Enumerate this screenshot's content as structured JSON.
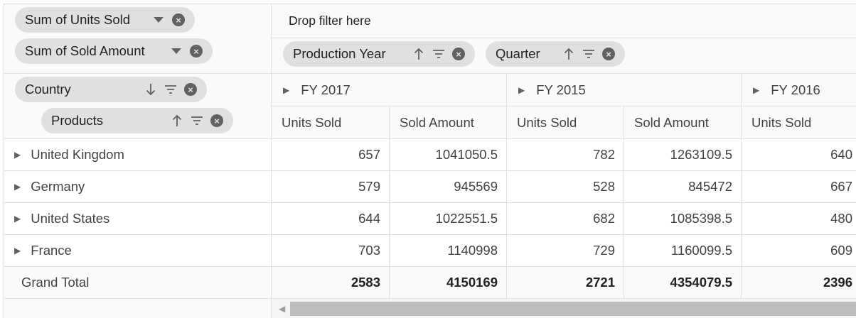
{
  "values_area": {
    "fields": [
      {
        "label": "Sum of Units Sold"
      },
      {
        "label": "Sum of Sold Amount"
      }
    ]
  },
  "filter_area": {
    "placeholder": "Drop filter here"
  },
  "column_area": {
    "fields": [
      {
        "label": "Production Year",
        "sort": "ascending"
      },
      {
        "label": "Quarter",
        "sort": "ascending"
      }
    ]
  },
  "row_area": {
    "fields": [
      {
        "label": "Country",
        "sort": "descending"
      },
      {
        "label": "Products",
        "sort": "ascending"
      }
    ]
  },
  "grid": {
    "column_groups": [
      "FY 2017",
      "FY 2015",
      "FY 2016"
    ],
    "measures": [
      "Units Sold",
      "Sold Amount",
      "Units Sold",
      "Sold Amount",
      "Units Sold"
    ],
    "rows": [
      {
        "label": "United Kingdom",
        "values": [
          "657",
          "1041050.5",
          "782",
          "1263109.5",
          "640"
        ]
      },
      {
        "label": "Germany",
        "values": [
          "579",
          "945569",
          "528",
          "845472",
          "667"
        ]
      },
      {
        "label": "United States",
        "values": [
          "644",
          "1022551.5",
          "682",
          "1085398.5",
          "480"
        ]
      },
      {
        "label": "France",
        "values": [
          "703",
          "1140998",
          "729",
          "1160099.5",
          "609"
        ]
      }
    ],
    "grand_total": {
      "label": "Grand Total",
      "values": [
        "2583",
        "4150169",
        "2721",
        "4354079.5",
        "2396"
      ]
    }
  },
  "icons": {
    "dropdown": "caret-down-icon",
    "remove": "close-circle-icon",
    "filter": "filter-icon",
    "sort_asc": "arrow-up-icon",
    "sort_desc": "arrow-down-icon",
    "expand": "expand-triangle-icon"
  }
}
